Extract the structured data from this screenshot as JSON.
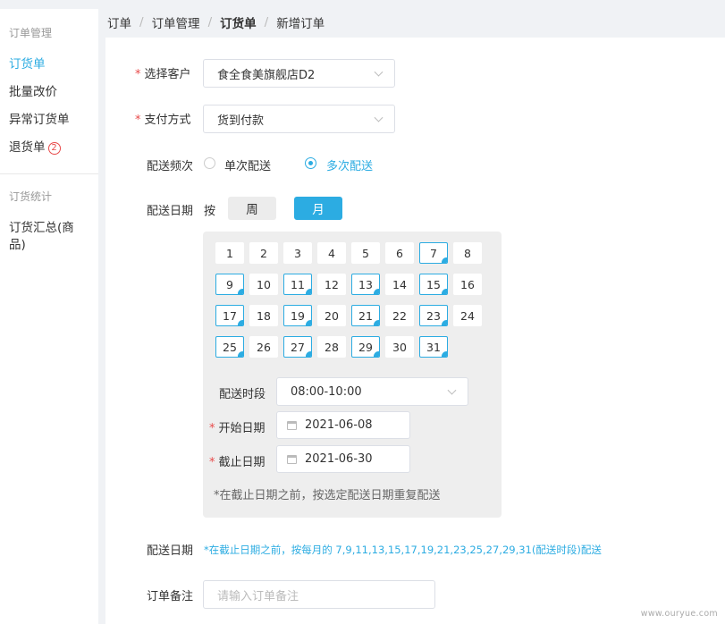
{
  "sidebar": {
    "group1": "订单管理",
    "items1": [
      {
        "label": "订货单",
        "active": true
      },
      {
        "label": "批量改价"
      },
      {
        "label": "异常订货单"
      },
      {
        "label": "退货单",
        "badge": "2"
      }
    ],
    "group2": "订货统计",
    "items2_line1": "订货汇总(商",
    "items2_line2": "品)"
  },
  "breadcrumb": [
    "订单",
    "订单管理",
    "订货单",
    "新增订单"
  ],
  "form": {
    "customer_label": "选择客户",
    "customer_value": "食全食美旗舰店D2",
    "payment_label": "支付方式",
    "payment_value": "货到付款",
    "freq_label": "配送频次",
    "freq_options": [
      "单次配送",
      "多次配送"
    ],
    "freq_selected": "多次配送",
    "date_label": "配送日期",
    "by_label": "按",
    "mode_week": "周",
    "mode_month": "月",
    "days": [
      "1",
      "2",
      "3",
      "4",
      "5",
      "6",
      "7",
      "8",
      "9",
      "10",
      "11",
      "12",
      "13",
      "14",
      "15",
      "16",
      "17",
      "18",
      "19",
      "20",
      "21",
      "22",
      "23",
      "24",
      "25",
      "26",
      "27",
      "28",
      "29",
      "30",
      "31"
    ],
    "selected_days": [
      7,
      9,
      11,
      13,
      15,
      17,
      19,
      21,
      23,
      25,
      27,
      29,
      31
    ],
    "slot_label": "配送时段",
    "slot_value": "08:00-10:00",
    "start_label": "开始日期",
    "start_value": "2021-06-08",
    "end_label": "截止日期",
    "end_value": "2021-06-30",
    "repeat_hint": "*在截止日期之前，按选定配送日期重复配送",
    "summary_label": "配送日期",
    "summary_text": "*在截止日期之前，按每月的 7,9,11,13,15,17,19,21,23,25,27,29,31(配送时段)配送",
    "remark_label": "订单备注",
    "remark_placeholder": "请输入订单备注"
  },
  "watermark": "www.ouryue.com",
  "colors": {
    "accent": "#2cace2",
    "required": "#e84a4a"
  }
}
